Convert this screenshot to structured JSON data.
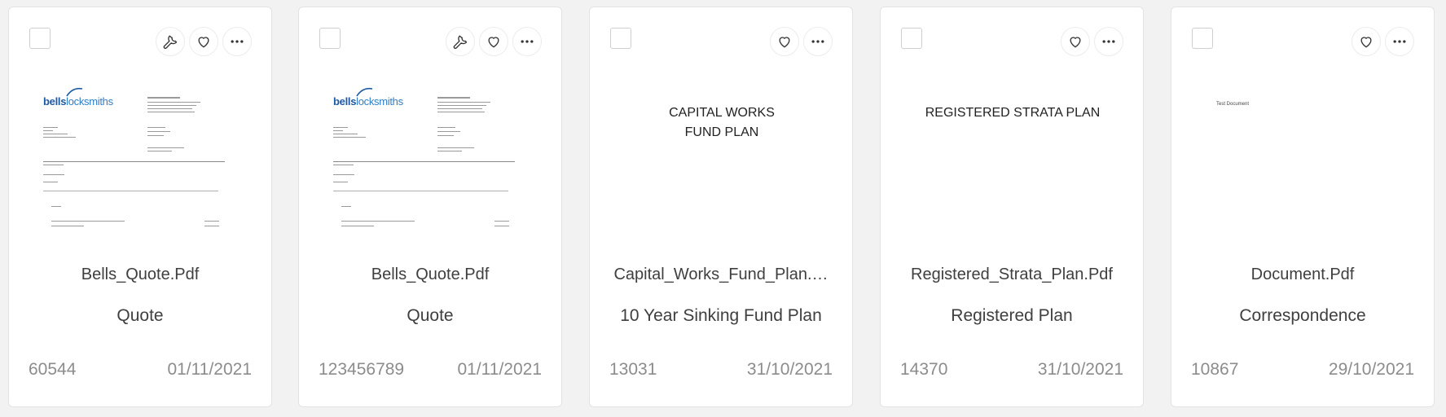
{
  "cards": [
    {
      "name": "Bells_Quote.Pdf",
      "type": "Quote",
      "id": "60544",
      "date": "01/11/2021",
      "has_tool": true,
      "preview": "letterhead",
      "logo_a": "bells",
      "logo_b": "locksmiths"
    },
    {
      "name": "Bells_Quote.Pdf",
      "type": "Quote",
      "id": "123456789",
      "date": "01/11/2021",
      "has_tool": true,
      "preview": "letterhead",
      "logo_a": "bells",
      "logo_b": "locksmiths"
    },
    {
      "name": "Capital_Works_Fund_Plan.…",
      "type": "10 Year Sinking Fund Plan",
      "id": "13031",
      "date": "31/10/2021",
      "has_tool": false,
      "preview": "title",
      "preview_line1": "CAPITAL WORKS",
      "preview_line2": "FUND PLAN"
    },
    {
      "name": "Registered_Strata_Plan.Pdf",
      "type": "Registered Plan",
      "id": "14370",
      "date": "31/10/2021",
      "has_tool": false,
      "preview": "title",
      "preview_line1": "REGISTERED STRATA PLAN",
      "preview_line2": ""
    },
    {
      "name": "Document.Pdf",
      "type": "Correspondence",
      "id": "10867",
      "date": "29/10/2021",
      "has_tool": false,
      "preview": "tiny",
      "preview_line1": "Test Document"
    }
  ],
  "icons": {
    "tool": "wrench-icon",
    "favorite": "heart-icon",
    "more": "more-dots-icon"
  },
  "colors": {
    "background": "#f2f2f2",
    "card": "#ffffff",
    "meta_text": "#8c8c8c",
    "logo_blue": "#1d5aa3"
  }
}
